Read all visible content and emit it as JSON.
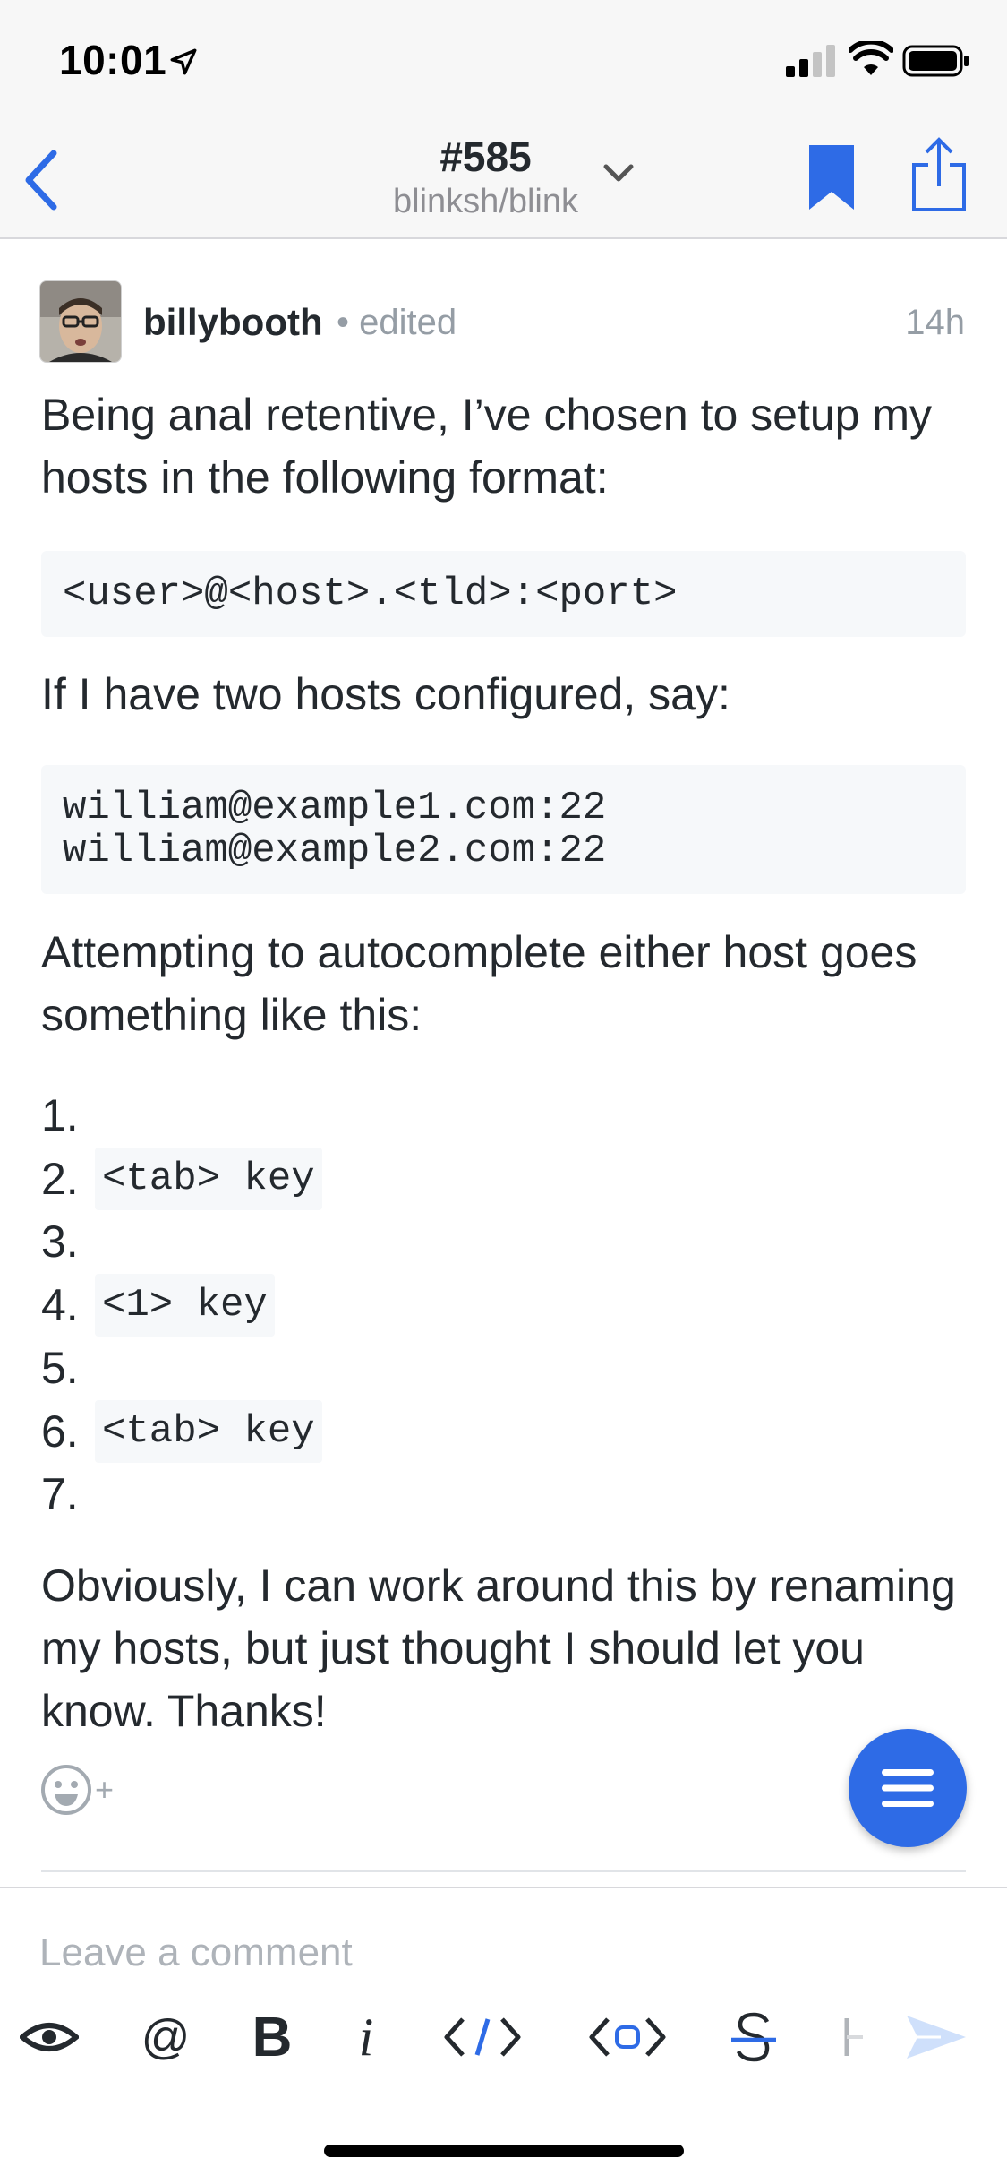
{
  "status": {
    "time": "10:01"
  },
  "nav": {
    "title": "#585",
    "subtitle": "blinksh/blink"
  },
  "comment": {
    "author": "billybooth",
    "edited_label": "• edited",
    "age": "14h",
    "paragraphs": [
      "Being anal retentive, I’ve chosen to setup my hosts in the following format:",
      "If I have two hosts configured, say:",
      "Attempting to autocomplete either host goes something like this:",
      "Obviously, I can work around this by renaming my hosts, but just thought I should let you know.  Thanks!"
    ],
    "code_format": "<user>@<host>.<tld>:<port>",
    "code_hosts": [
      "william@example1.com:22",
      "william@example2.com:22"
    ],
    "steps": [
      {
        "num": "1.",
        "code": ""
      },
      {
        "num": "2.",
        "code": "<tab> key"
      },
      {
        "num": "3.",
        "code": ""
      },
      {
        "num": "4.",
        "code": "<1> key"
      },
      {
        "num": "5.",
        "code": ""
      },
      {
        "num": "6.",
        "code": "<tab> key"
      },
      {
        "num": "7.",
        "code": ""
      }
    ],
    "reaction_plus": "+"
  },
  "composer": {
    "placeholder": "Leave a comment",
    "toolbar": [
      "preview-icon",
      "mention-icon",
      "bold-icon",
      "italic-icon",
      "code-icon",
      "code-block-icon",
      "strikethrough-icon",
      "heading-icon",
      "send-icon"
    ],
    "mention_glyph": "@",
    "bold_glyph": "B",
    "italic_glyph": "i"
  },
  "colors": {
    "accent": "#2e6be6",
    "text": "#24292e",
    "muted": "#959da5",
    "code_bg": "#f6f8fa"
  }
}
